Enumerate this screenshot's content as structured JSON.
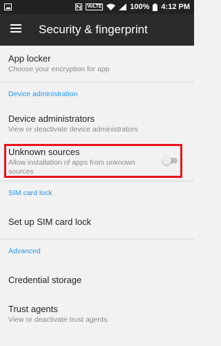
{
  "status_bar": {
    "battery": "100%",
    "time": "4:12 PM",
    "network_badge": "VoLTE",
    "icons": [
      "image-icon",
      "nfc-icon",
      "volte-icon",
      "wifi-icon",
      "signal-icon",
      "battery-icon"
    ]
  },
  "appbar": {
    "title": "Security & fingerprint",
    "menu_icon": "hamburger-menu-icon"
  },
  "items": {
    "app_locker": {
      "title": "App locker",
      "subtitle": "Choose your encryption for app"
    },
    "device_admins": {
      "title": "Device administrators",
      "subtitle": "View or deactivate device administrators"
    },
    "unknown_sources": {
      "title": "Unknown sources",
      "subtitle": "Allow installation of apps from unknown sources",
      "enabled": false
    },
    "sim_lock": {
      "title": "Set up SIM card lock"
    },
    "credential_storage": {
      "title": "Credential storage"
    },
    "trust_agents": {
      "title": "Trust agents",
      "subtitle": "View or deactivate trust agents"
    }
  },
  "sections": {
    "device_administration": "Device administration",
    "sim_card_lock": "SIM card lock",
    "advanced": "Advanced"
  },
  "colors": {
    "accent": "#2196f3",
    "highlight_border": "#e8141c",
    "appbar": "#2b2b2b",
    "statusbar": "#222222",
    "background": "#f2f2f2"
  }
}
